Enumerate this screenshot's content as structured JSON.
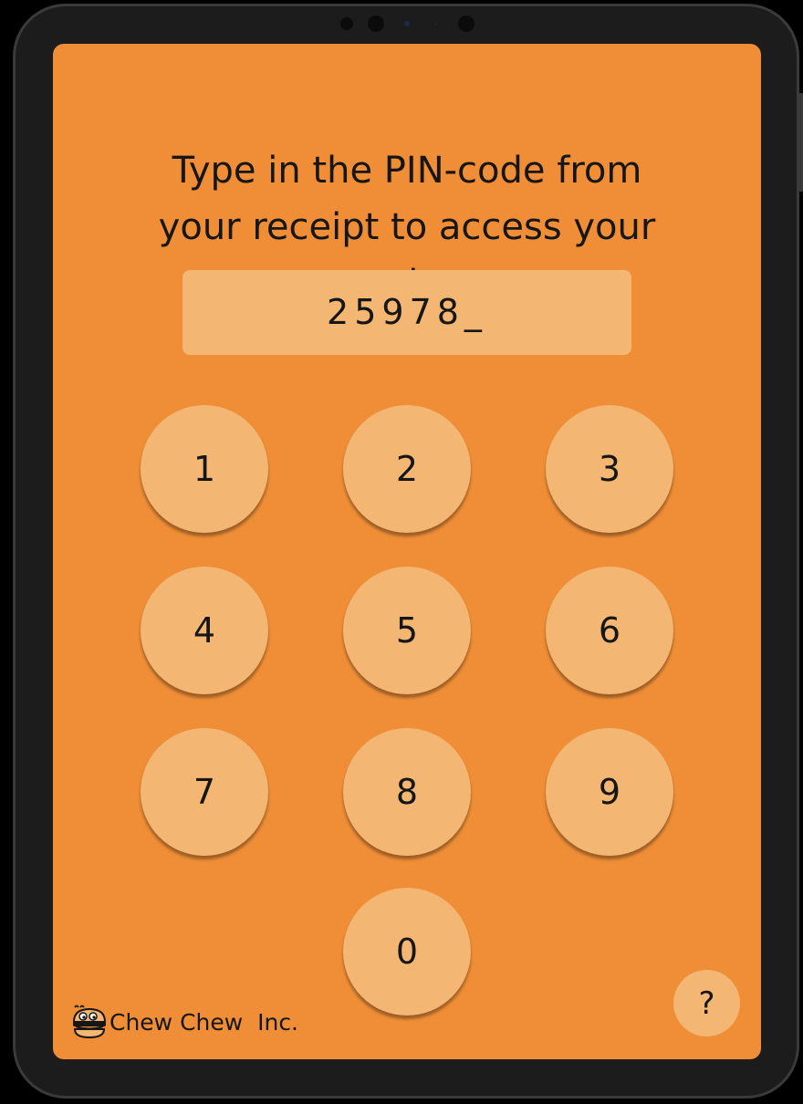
{
  "prompt": {
    "line1": "Type in the  PIN-code from",
    "line2": "your receipt to access your",
    "line3": "order"
  },
  "pin": {
    "value": "25978_"
  },
  "keypad": {
    "k1": "1",
    "k2": "2",
    "k3": "3",
    "k4": "4",
    "k5": "5",
    "k6": "6",
    "k7": "7",
    "k8": "8",
    "k9": "9",
    "k0": "0"
  },
  "help": {
    "label": "?"
  },
  "brand": {
    "name": "Chew Chew  Inc.",
    "logo_icon": "burger-mascot-icon"
  },
  "colors": {
    "screen_bg": "#ef8e37",
    "key_bg": "#f3b673",
    "text": "#161616",
    "device_frame": "#1c1c1c"
  }
}
